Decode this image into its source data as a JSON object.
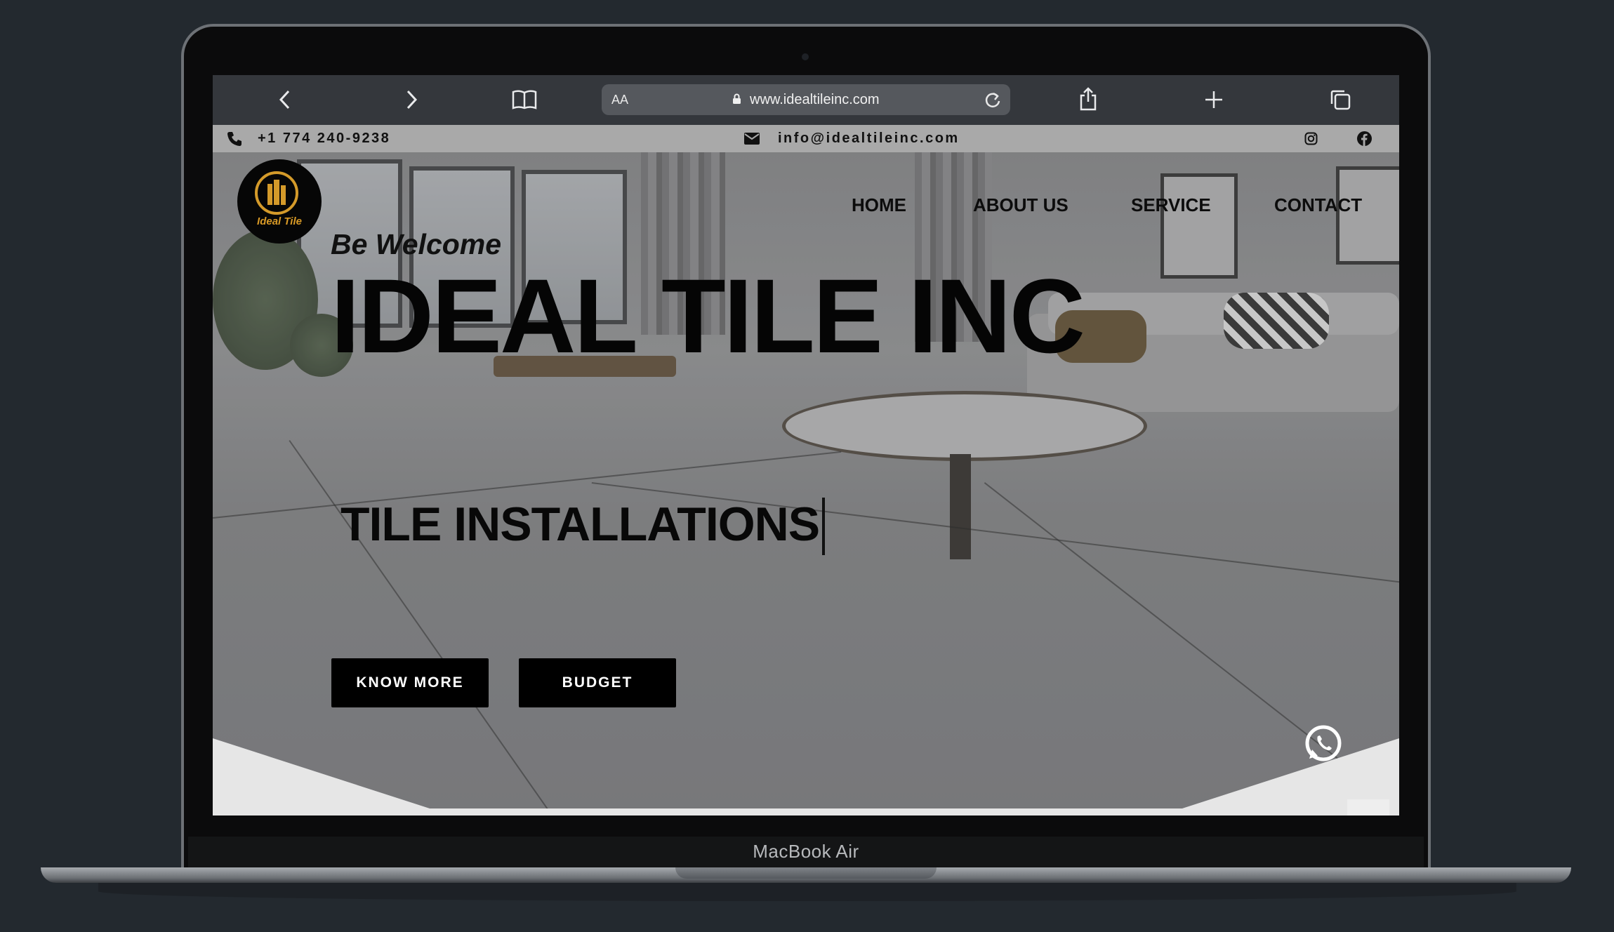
{
  "device": {
    "label": "MacBook Air"
  },
  "browser": {
    "url": "www.idealtileinc.com",
    "reader_label": "AA",
    "icons": [
      "chevron-left-icon",
      "chevron-right-icon",
      "book-icon",
      "lock-icon",
      "reload-icon",
      "share-icon",
      "plus-icon",
      "tabs-icon"
    ]
  },
  "topbar": {
    "phone": "+1 774 240-9238",
    "email": "info@idealtileinc.com",
    "social_icons": [
      "instagram-icon",
      "facebook-icon"
    ]
  },
  "logo": {
    "text": "Ideal Tile",
    "color": "#d99a26"
  },
  "nav": {
    "items": [
      "HOME",
      "ABOUT US",
      "SERVICE",
      "CONTACT"
    ]
  },
  "hero": {
    "welcome": "Be Welcome",
    "title": "IDEAL TILE INC",
    "subtitle": "TILE INSTALLATIONS",
    "buttons": {
      "know_more": "KNOW MORE",
      "budget": "BUDGET"
    }
  },
  "floating": {
    "icons": [
      "whatsapp-icon"
    ]
  }
}
